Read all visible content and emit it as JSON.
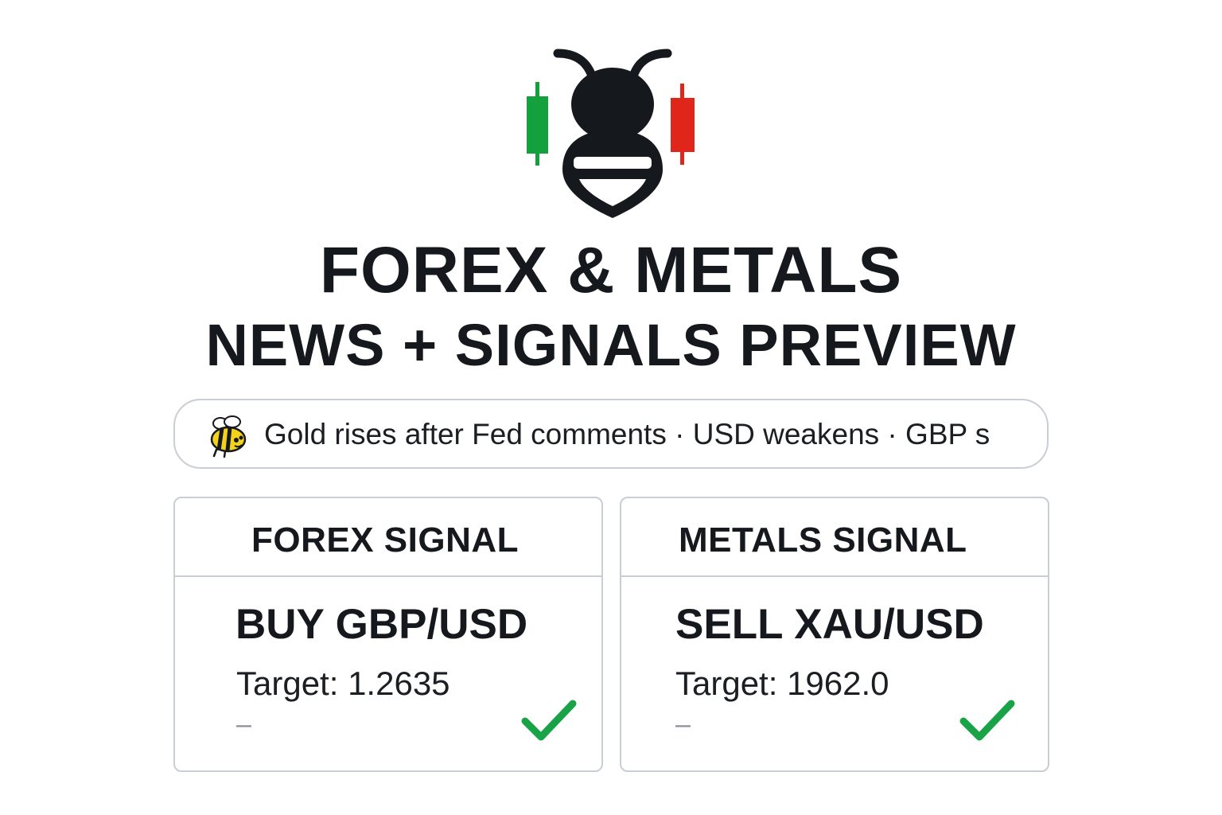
{
  "logo": {
    "icon": "bee-candlestick-logo-icon",
    "colors": {
      "bee": "#15181c",
      "candle_up": "#14a03c",
      "candle_down": "#e0251b"
    }
  },
  "title": {
    "line1": "FOREX & METALS",
    "line2": "NEWS + SIGNALS PREVIEW"
  },
  "ticker": {
    "icon": "bee-icon",
    "text": "Gold rises after Fed comments · USD weakens · GBP s"
  },
  "signals": [
    {
      "header": "FOREX SIGNAL",
      "action": "BUY GBP/USD",
      "target": "Target: 1.2635",
      "extra": "–",
      "status_icon": "checkmark-icon"
    },
    {
      "header": "METALS SIGNAL",
      "action": "SELL XAU/USD",
      "target": "Target: 1962.0",
      "extra": "–",
      "status_icon": "checkmark-icon"
    }
  ],
  "colors": {
    "text": "#15181c",
    "border": "#c9ced6",
    "check": "#19a347",
    "muted": "#8a9099"
  }
}
